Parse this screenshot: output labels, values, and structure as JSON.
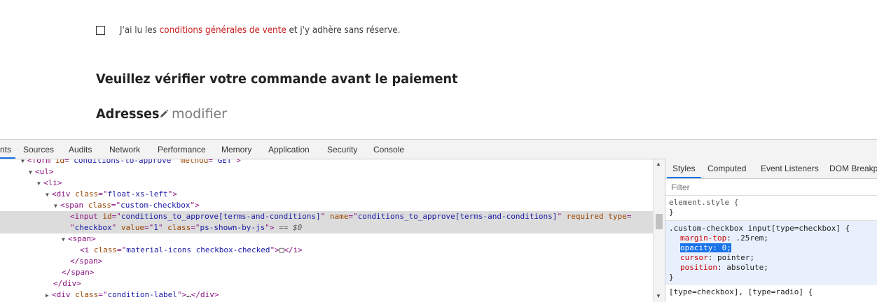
{
  "page": {
    "terms_prefix": "J'ai lu les ",
    "terms_link": "conditions générales de vente",
    "terms_suffix": " et j'y adhère sans réserve.",
    "heading": "Veuillez vérifier votre commande avant le paiement",
    "addresses_title": "Adresses",
    "modify_link": "modifier",
    "link_color": "#c71e1e"
  },
  "devtools": {
    "tabs": [
      "nts",
      "Sources",
      "Audits",
      "Network",
      "Performance",
      "Memory",
      "Application",
      "Security",
      "Console"
    ],
    "dom_lines": [
      "<form id=\"conditions-to-approve\" method=\"GET\">",
      "<ul>",
      "<li>",
      "<div class=\"float-xs-left\">",
      "<span class=\"custom-checkbox\">",
      "<input id=\"conditions_to_approve[terms-and-conditions]\" name=\"conditions_to_approve[terms-and-conditions]\" required type=",
      "\"checkbox\" value=\"1\" class=\"ps-shown-by-js\"> == $0",
      "<span>",
      "<i class=\"material-icons checkbox-checked\"></i>",
      "</span>",
      "</span>",
      "</div>",
      "<div class=\"condition-label\">…</div>"
    ],
    "styles_tabs": [
      "Styles",
      "Computed",
      "Event Listeners",
      "DOM Breakp"
    ],
    "filter_placeholder": "Filter",
    "element_style": "element.style {",
    "close_brace": "}",
    "rule_selector": ".custom-checkbox input[type=checkbox] {",
    "rule_props": [
      {
        "name": "margin-top",
        "value": ".25rem"
      },
      {
        "name": "opacity",
        "value": "0"
      },
      {
        "name": "cursor",
        "value": "pointer"
      },
      {
        "name": "position",
        "value": "absolute"
      }
    ],
    "next_rule": "[type=checkbox], [type=radio] {",
    "selected_note": "== $0"
  }
}
